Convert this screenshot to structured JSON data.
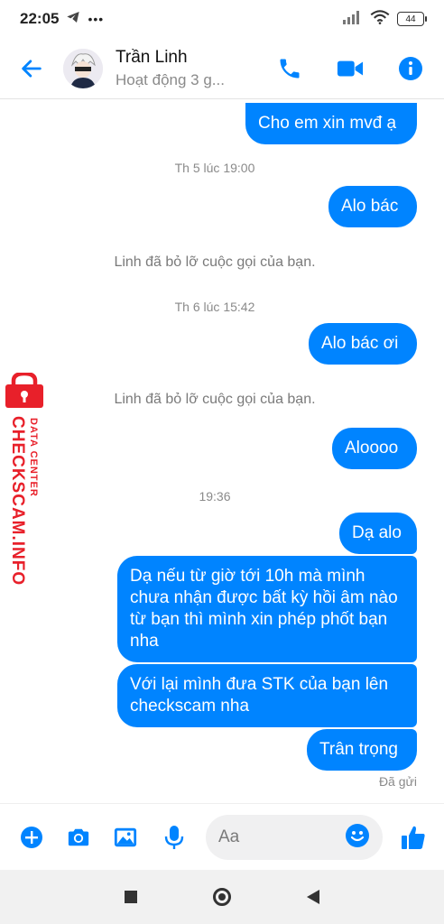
{
  "status_bar": {
    "time": "22:05",
    "battery": "44",
    "more": "•••"
  },
  "header": {
    "name": "Trần Linh",
    "status": "Hoạt động 3 g..."
  },
  "messages": {
    "m1": "Cho em xin mvđ ạ",
    "ts1": "Th 5 lúc 19:00",
    "m2": "Alo bác",
    "sys1": "Linh đã bỏ lỡ cuộc gọi của bạn.",
    "ts2": "Th 6 lúc 15:42",
    "m3": "Alo bác ơi",
    "sys2": "Linh đã bỏ lỡ cuộc gọi của bạn.",
    "m4": "Aloooo",
    "ts3": "19:36",
    "m5": "Dạ alo",
    "m6": "Dạ nếu từ giờ tới 10h mà mình chưa nhận được bất kỳ hồi âm nào từ bạn thì mình xin phép phốt bạn nha",
    "m7": "Với lại mình đưa STK của bạn lên checkscam nha",
    "m8": "Trân trọng",
    "receipt": "Đã gửi"
  },
  "watermark": {
    "line1": "DATA CENTER",
    "line2": "CHECKSCAM.INFO"
  },
  "composer": {
    "placeholder": "Aa"
  },
  "colors": {
    "accent": "#0084ff",
    "watermark": "#e8202a"
  }
}
